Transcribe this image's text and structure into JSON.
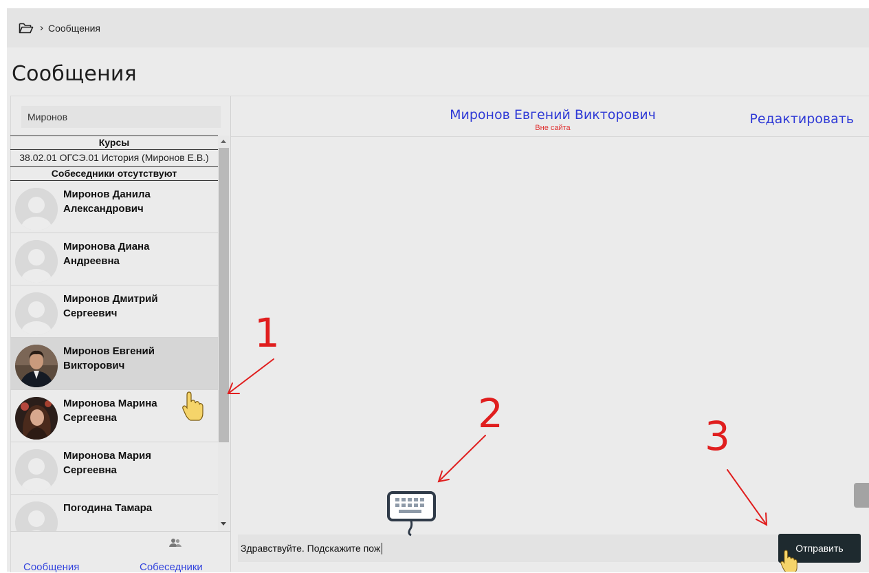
{
  "breadcrumb": {
    "separator": "›",
    "current": "Сообщения"
  },
  "page_title": "Сообщения",
  "search": {
    "value": "Миронов"
  },
  "sidebar": {
    "courses_heading": "Курсы",
    "course_item": "38.02.01 ОГСЭ.01 История (Миронов Е.В.)",
    "contacts_heading": "Собеседники отсутствуют",
    "contacts": [
      {
        "name": "Миронов Данила Александрович",
        "avatar": "default"
      },
      {
        "name": "Миронова Диана Андреевна",
        "avatar": "default"
      },
      {
        "name": "Миронов Дмитрий Сергеевич",
        "avatar": "default"
      },
      {
        "name": "Миронов Евгений Викторович",
        "avatar": "photo-man",
        "active": true
      },
      {
        "name": "Миронова Марина Сергеевна",
        "avatar": "photo-woman"
      },
      {
        "name": "Миронова Мария Сергеевна",
        "avatar": "default"
      },
      {
        "name": "Погодина Тамара",
        "avatar": "default"
      }
    ]
  },
  "footer_tabs": {
    "messages": "Сообщения",
    "contacts": "Собеседники"
  },
  "chat": {
    "contact_name": "Миронов Евгений Викторович",
    "status": "Вне сайта",
    "edit_label": "Редактировать",
    "message_value": "Здравствуйте. Подскажите пож",
    "send_label": "Отправить"
  },
  "annotations": {
    "labels": [
      "1",
      "2",
      "3"
    ],
    "color": "#e01e1e"
  },
  "colors": {
    "link": "#2f3ad6",
    "status_offline": "#e03030",
    "send_button": "#1e2a2f"
  }
}
